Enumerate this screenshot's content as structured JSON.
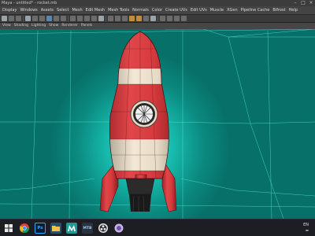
{
  "app": {
    "title": "Maya - untitled* - rocket.mb",
    "accent": "#0fb2a5"
  },
  "menus": [
    "Display",
    "Windows",
    "Assets",
    "Select",
    "Mesh",
    "Edit Mesh",
    "Mesh Tools",
    "Normals",
    "Color",
    "Create UVs",
    "Edit UVs",
    "Muscle",
    "XGen",
    "Pipeline Cache",
    "Bifrost",
    "Help"
  ],
  "panel_menus": [
    "View",
    "Shading",
    "Lighting",
    "Show",
    "Renderer",
    "Panels"
  ],
  "taskbar": {
    "icons": [
      "windows-start-icon",
      "chrome-icon",
      "photoshop-icon",
      "file-explorer-icon",
      "maya-icon",
      "mtb-icon",
      "obs-icon",
      "app-icon"
    ],
    "ps_label": "Ps",
    "mtb_label": "MTB",
    "language": "EN"
  },
  "viewport": {
    "background_color": "#0fb2a5",
    "model": "rocket",
    "colors": {
      "body_red": "#d6373a",
      "body_cream": "#eee3cf",
      "window_frame": "#2a2a2a"
    }
  }
}
